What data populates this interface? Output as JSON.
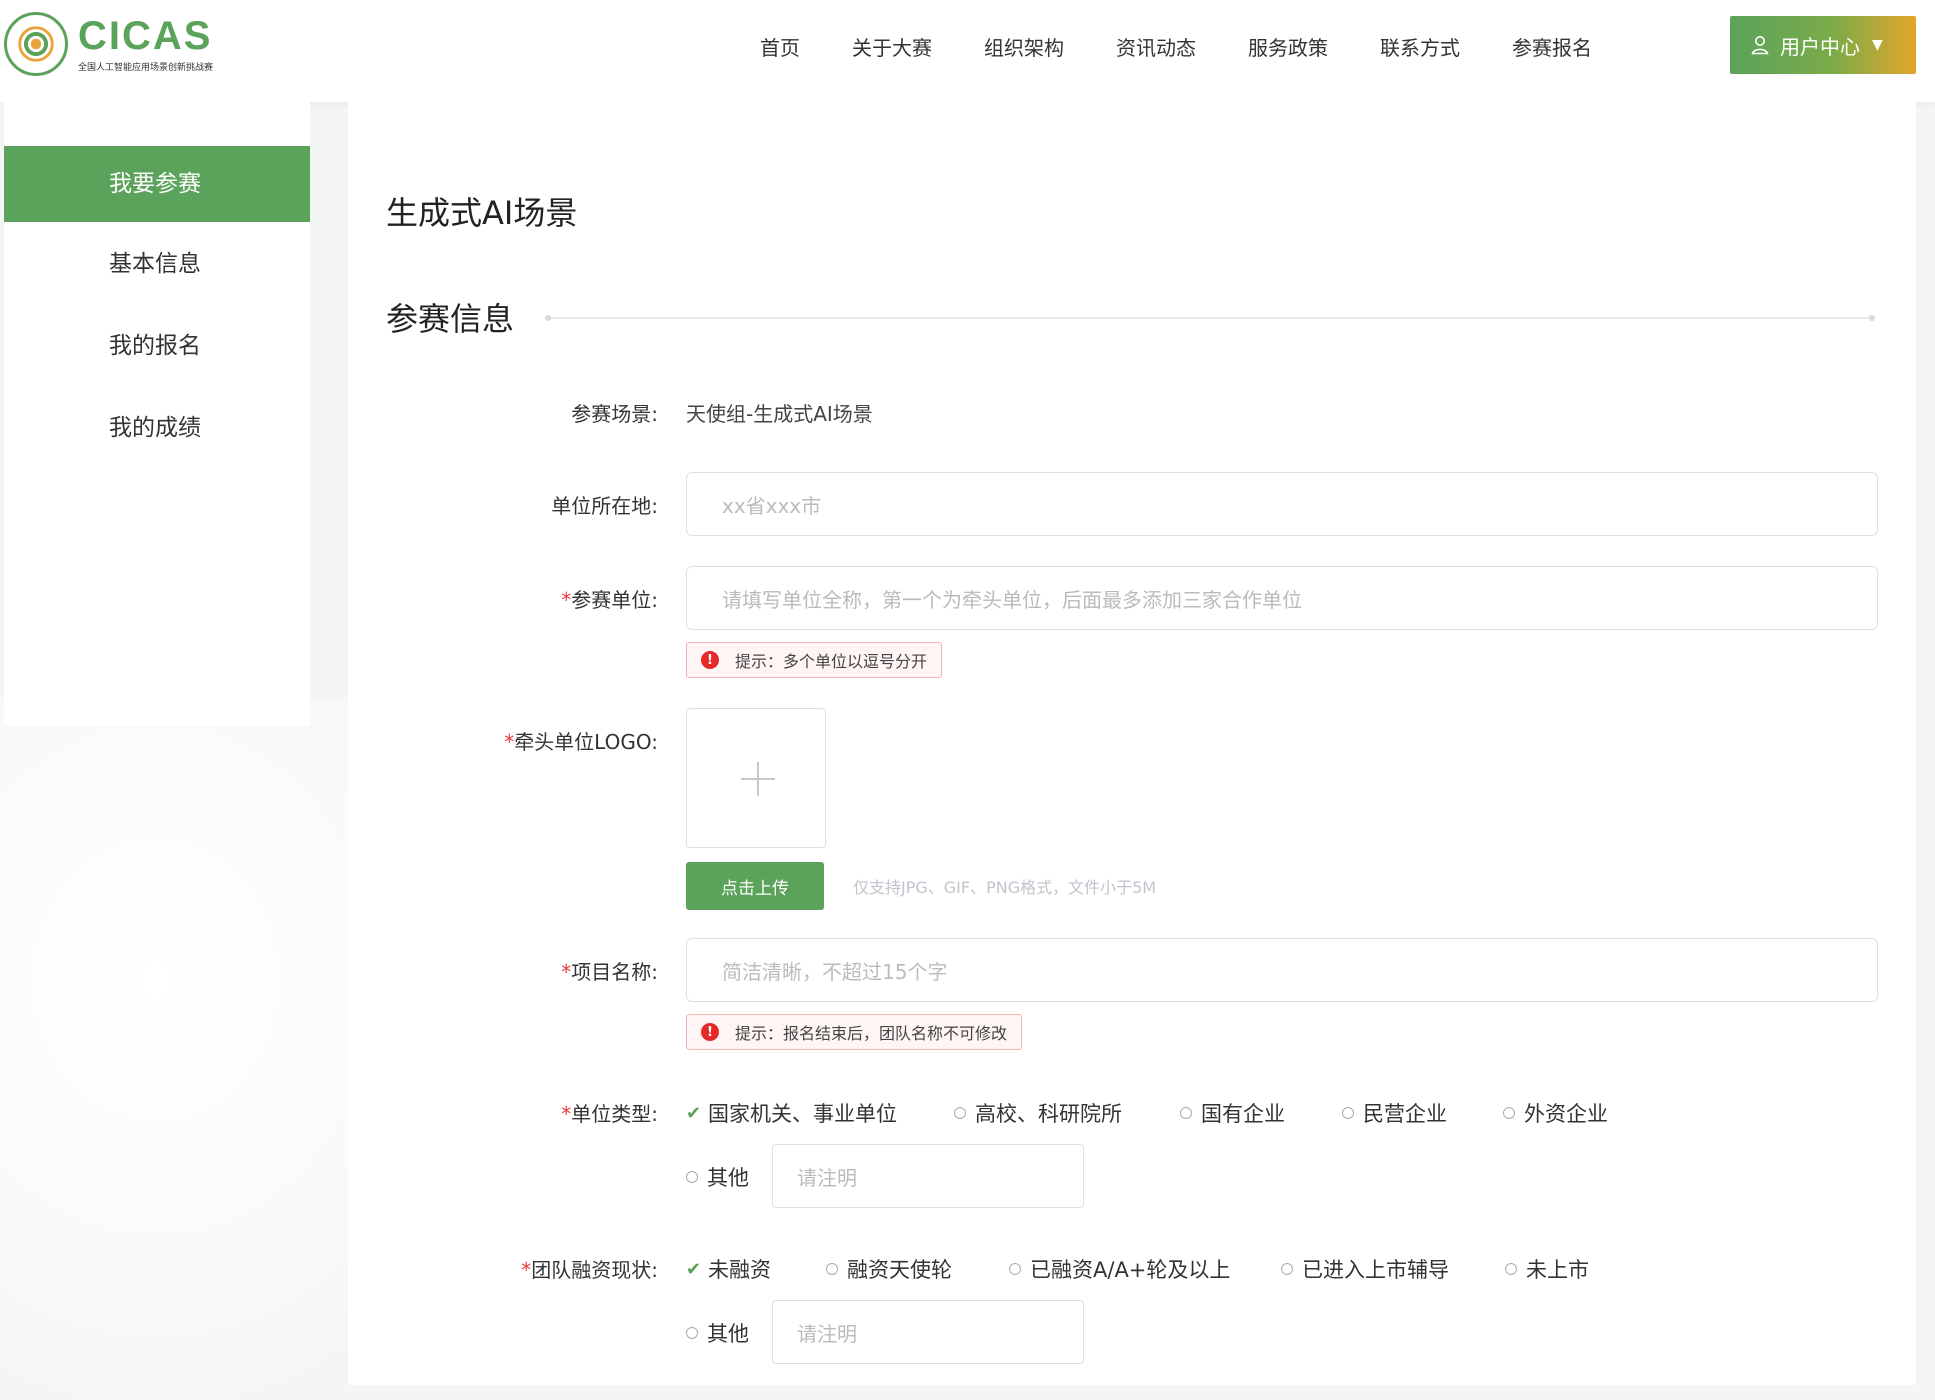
{
  "header": {
    "logo_text": "CICAS",
    "logo_subtitle": "全国人工智能应用场景创新挑战赛",
    "nav": [
      "首页",
      "关于大赛",
      "组织架构",
      "资讯动态",
      "服务政策",
      "联系方式",
      "参赛报名"
    ],
    "user_center": "用户中心"
  },
  "sidebar": {
    "items": [
      "我要参赛",
      "基本信息",
      "我的报名",
      "我的成绩"
    ],
    "active_index": 0
  },
  "page": {
    "title": "生成式AI场景",
    "section_title": "参赛信息"
  },
  "form": {
    "scene": {
      "label": "参赛场景:",
      "value": "天使组-生成式AI场景"
    },
    "location": {
      "label": "单位所在地:",
      "placeholder": "xx省xxx市"
    },
    "org": {
      "required": "*",
      "label": "参赛单位:",
      "placeholder": "请填写单位全称，第一个为牵头单位，后面最多添加三家合作单位",
      "hint": "提示：多个单位以逗号分开"
    },
    "logo": {
      "required": "*",
      "label": "牵头单位LOGO:",
      "upload_button": "点击上传",
      "upload_tip": "仅支持JPG、GIF、PNG格式，文件小于5M"
    },
    "project": {
      "required": "*",
      "label": "项目名称:",
      "placeholder": "简洁清晰，不超过15个字",
      "hint": "提示：报名结束后，团队名称不可修改"
    },
    "org_type": {
      "required": "*",
      "label": "单位类型:",
      "options": [
        "国家机关、事业单位",
        "高校、科研院所",
        "国有企业",
        "民营企业",
        "外资企业",
        "其他"
      ],
      "selected": "国家机关、事业单位",
      "other_placeholder": "请注明"
    },
    "funding": {
      "required": "*",
      "label": "团队融资现状:",
      "options": [
        "未融资",
        "融资天使轮",
        "已融资A/A+轮及以上",
        "已进入上市辅导",
        "未上市",
        "其他"
      ],
      "selected": "未融资",
      "other_placeholder": "请注明"
    }
  },
  "colors": {
    "brand_green": "#5ba35b",
    "accent_orange": "#e3a52b",
    "error_red": "#e62a2a"
  }
}
